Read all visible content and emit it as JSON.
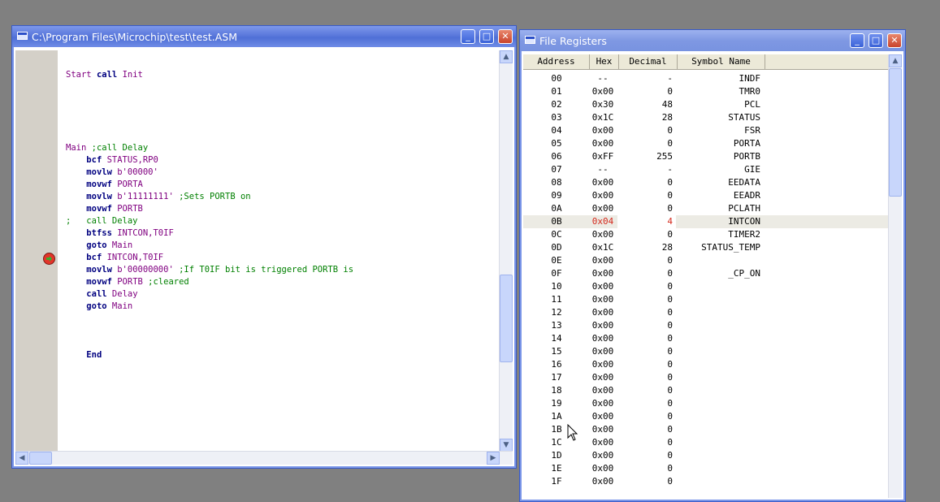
{
  "editor": {
    "title": "C:\\Program Files\\Microchip\\test\\test.ASM",
    "lines": [
      {
        "text": "Start call Init",
        "row": 0
      },
      {
        "text": "Main ;call Delay",
        "row": 6
      },
      {
        "text": "    bcf STATUS,RP0",
        "row": 7
      },
      {
        "text": "    movlw b'00000'",
        "row": 8
      },
      {
        "text": "    movwf PORTA",
        "row": 9
      },
      {
        "text": "    movlw b'11111111' ;Sets PORTB on",
        "row": 10
      },
      {
        "text": "    movwf PORTB",
        "row": 11
      },
      {
        "text": ";   call Delay",
        "row": 12
      },
      {
        "text": "    btfss INTCON,T0IF",
        "row": 13
      },
      {
        "text": "    goto Main",
        "row": 14
      },
      {
        "text": "    bcf INTCON,T0IF",
        "row": 15
      },
      {
        "text": "    movlw b'00000000' ;If T0IF bit is triggered PORTB is",
        "row": 16
      },
      {
        "text": "    movwf PORTB ;cleared",
        "row": 17
      },
      {
        "text": "    call Delay",
        "row": 18
      },
      {
        "text": "    goto Main",
        "row": 19
      },
      {
        "text": "    End",
        "row": 23
      }
    ],
    "breakpoint_row": 15
  },
  "registers": {
    "title": "File Registers",
    "columns": [
      "Address",
      "Hex",
      "Decimal",
      "Symbol Name"
    ],
    "selected": "0B",
    "rows": [
      [
        "00",
        "--",
        "-",
        "INDF"
      ],
      [
        "01",
        "0x00",
        "0",
        "TMR0"
      ],
      [
        "02",
        "0x30",
        "48",
        "PCL"
      ],
      [
        "03",
        "0x1C",
        "28",
        "STATUS"
      ],
      [
        "04",
        "0x00",
        "0",
        "FSR"
      ],
      [
        "05",
        "0x00",
        "0",
        "PORTA"
      ],
      [
        "06",
        "0xFF",
        "255",
        "PORTB"
      ],
      [
        "07",
        "--",
        "-",
        "GIE"
      ],
      [
        "08",
        "0x00",
        "0",
        "EEDATA"
      ],
      [
        "09",
        "0x00",
        "0",
        "EEADR"
      ],
      [
        "0A",
        "0x00",
        "0",
        "PCLATH"
      ],
      [
        "0B",
        "0x04",
        "4",
        "INTCON"
      ],
      [
        "0C",
        "0x00",
        "0",
        "TIMER2"
      ],
      [
        "0D",
        "0x1C",
        "28",
        "STATUS_TEMP"
      ],
      [
        "0E",
        "0x00",
        "0",
        ""
      ],
      [
        "0F",
        "0x00",
        "0",
        "_CP_ON"
      ],
      [
        "10",
        "0x00",
        "0",
        ""
      ],
      [
        "11",
        "0x00",
        "0",
        ""
      ],
      [
        "12",
        "0x00",
        "0",
        ""
      ],
      [
        "13",
        "0x00",
        "0",
        ""
      ],
      [
        "14",
        "0x00",
        "0",
        ""
      ],
      [
        "15",
        "0x00",
        "0",
        ""
      ],
      [
        "16",
        "0x00",
        "0",
        ""
      ],
      [
        "17",
        "0x00",
        "0",
        ""
      ],
      [
        "18",
        "0x00",
        "0",
        ""
      ],
      [
        "19",
        "0x00",
        "0",
        ""
      ],
      [
        "1A",
        "0x00",
        "0",
        ""
      ],
      [
        "1B",
        "0x00",
        "0",
        ""
      ],
      [
        "1C",
        "0x00",
        "0",
        ""
      ],
      [
        "1D",
        "0x00",
        "0",
        ""
      ],
      [
        "1E",
        "0x00",
        "0",
        ""
      ],
      [
        "1F",
        "0x00",
        "0",
        ""
      ]
    ]
  },
  "colors": {
    "keyword": "#000080",
    "label": "#800080",
    "operand": "#800080",
    "comment": "#008000",
    "selected_value": "#d42a1d"
  },
  "icons": {
    "window": "window-icon",
    "minimize": "minimize-icon",
    "maximize": "maximize-icon",
    "close": "close-icon",
    "breakpoint": "breakpoint-arrow-icon",
    "pointer": "mouse-pointer-icon"
  },
  "window_buttons": {
    "minimize": "_",
    "maximize": "□",
    "close": "✕"
  },
  "scroll_glyphs": {
    "up": "▲",
    "down": "▼",
    "left": "◀",
    "right": "▶"
  }
}
